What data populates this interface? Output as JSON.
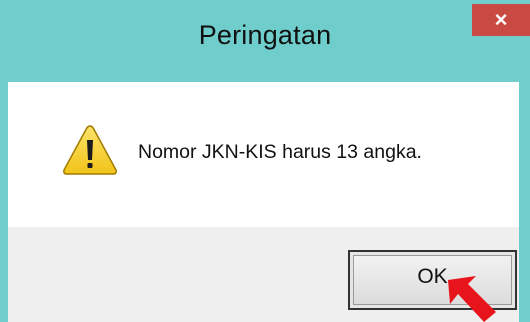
{
  "window": {
    "title": "Peringatan",
    "close_glyph": "×"
  },
  "dialog": {
    "icon": "warning-icon",
    "message": "Nomor JKN-KIS harus 13 angka.",
    "ok_label": "OK"
  },
  "colors": {
    "titlebar": "#6fcdcc",
    "close_button": "#c94a43",
    "button_area": "#efefef",
    "pointer_arrow": "#e8141b",
    "warning_yellow": "#f2c418"
  },
  "annotation": {
    "icon": "red-pointer-arrow-icon"
  }
}
